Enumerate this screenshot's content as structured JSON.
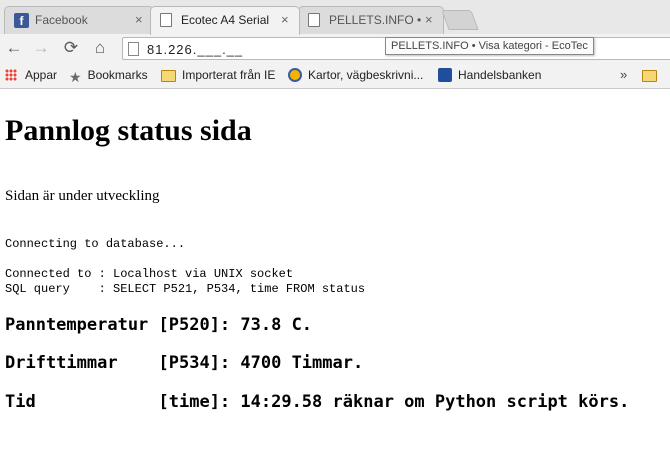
{
  "browser": {
    "tabs": [
      {
        "title": "Facebook",
        "close": "×",
        "icon": "facebook-icon",
        "icon_glyph": "f"
      },
      {
        "title": "Ecotec A4 Serial",
        "close": "×",
        "icon": "page-icon"
      },
      {
        "title": "PELLETS.INFO • V",
        "close": "×",
        "icon": "page-icon"
      }
    ],
    "toolbar": {
      "back": "←",
      "forward": "→",
      "reload": "⟳",
      "home": "⌂",
      "url": "81.226.___.__"
    },
    "tooltip": "PELLETS.INFO • Visa kategori - EcoTec",
    "bookmarks": {
      "apps": "Appar",
      "bookmarks": "Bookmarks",
      "imported": "Importerat från IE",
      "maps": "Kartor, vägbeskrivni...",
      "bank": "Handelsbanken",
      "overflow": "»"
    }
  },
  "page": {
    "title": "Pannlog status sida",
    "subtitle": "Sidan är under utveckling",
    "connecting": "Connecting to database...",
    "connected": "Connected to : Localhost via UNIX socket",
    "query": "SQL query    : SELECT P521, P534, time FROM status",
    "lines": [
      "Panntemperatur [P520]: 73.8 C.",
      "Drifttimmar    [P534]: 4700 Timmar.",
      "Tid            [time]: 14:29.58 räknar om Python script körs."
    ]
  }
}
